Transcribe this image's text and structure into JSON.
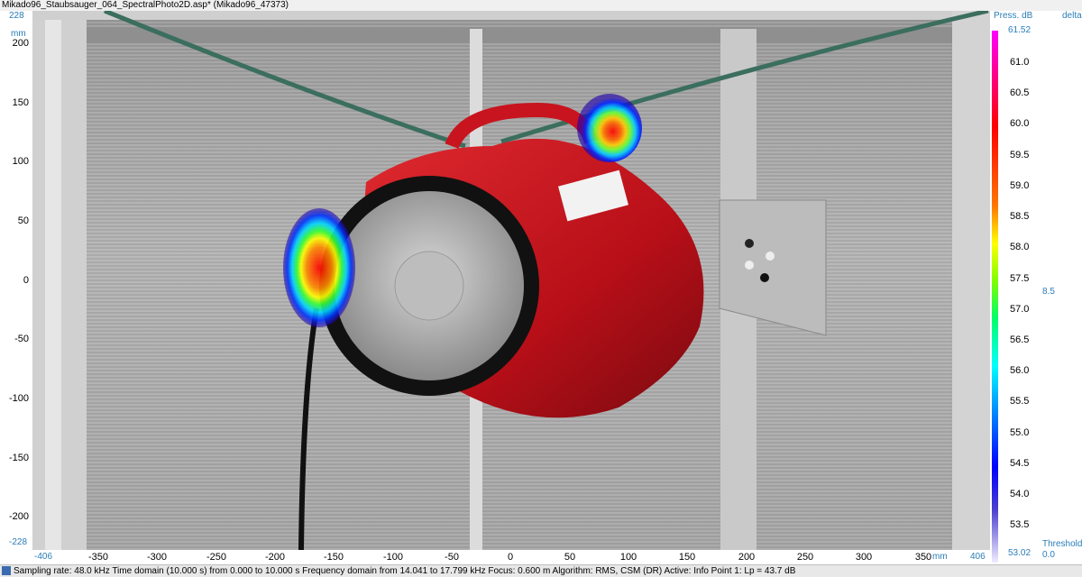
{
  "window": {
    "title": "Mikado96_Staubsauger_064_SpectralPhoto2D.asp* (Mikado96_47373)"
  },
  "y_axis": {
    "unit": "mm",
    "max_label": "228",
    "min_label": "-228",
    "ticks": [
      "200",
      "150",
      "100",
      "50",
      "0",
      "-50",
      "-100",
      "-150",
      "-200"
    ]
  },
  "x_axis": {
    "unit": "mm",
    "min_label": "-406",
    "max_label": "406",
    "ticks": [
      "-350",
      "-300",
      "-250",
      "-200",
      "-150",
      "-100",
      "-50",
      "0",
      "50",
      "100",
      "150",
      "200",
      "250",
      "300",
      "350"
    ]
  },
  "legend": {
    "header_left": "Press. dB",
    "header_right": "delta",
    "top_value": "61.52",
    "bottom_value": "53.02",
    "ticks": [
      "61.0",
      "60.5",
      "60.0",
      "59.5",
      "59.0",
      "58.5",
      "58.0",
      "57.5",
      "57.0",
      "56.5",
      "56.0",
      "55.5",
      "55.0",
      "54.5",
      "54.0",
      "53.5"
    ],
    "delta_value": "8.5",
    "threshold_label": "Threshold",
    "threshold_value": "0.0"
  },
  "status": {
    "text": "Sampling rate: 48.0 kHz Time domain (10.000 s) from 0.000 to 10.000 s Frequency domain from 14.041 to 17.799 kHz Focus: 0.600 m Algorithm: RMS, CSM (DR) Active: Info Point 1: Lp = 43.7 dB"
  },
  "colors": {
    "accent": "#2a7db8",
    "device": "#c8141e"
  },
  "icons": [
    "status-icon",
    "hotspot-left",
    "hotspot-top"
  ]
}
